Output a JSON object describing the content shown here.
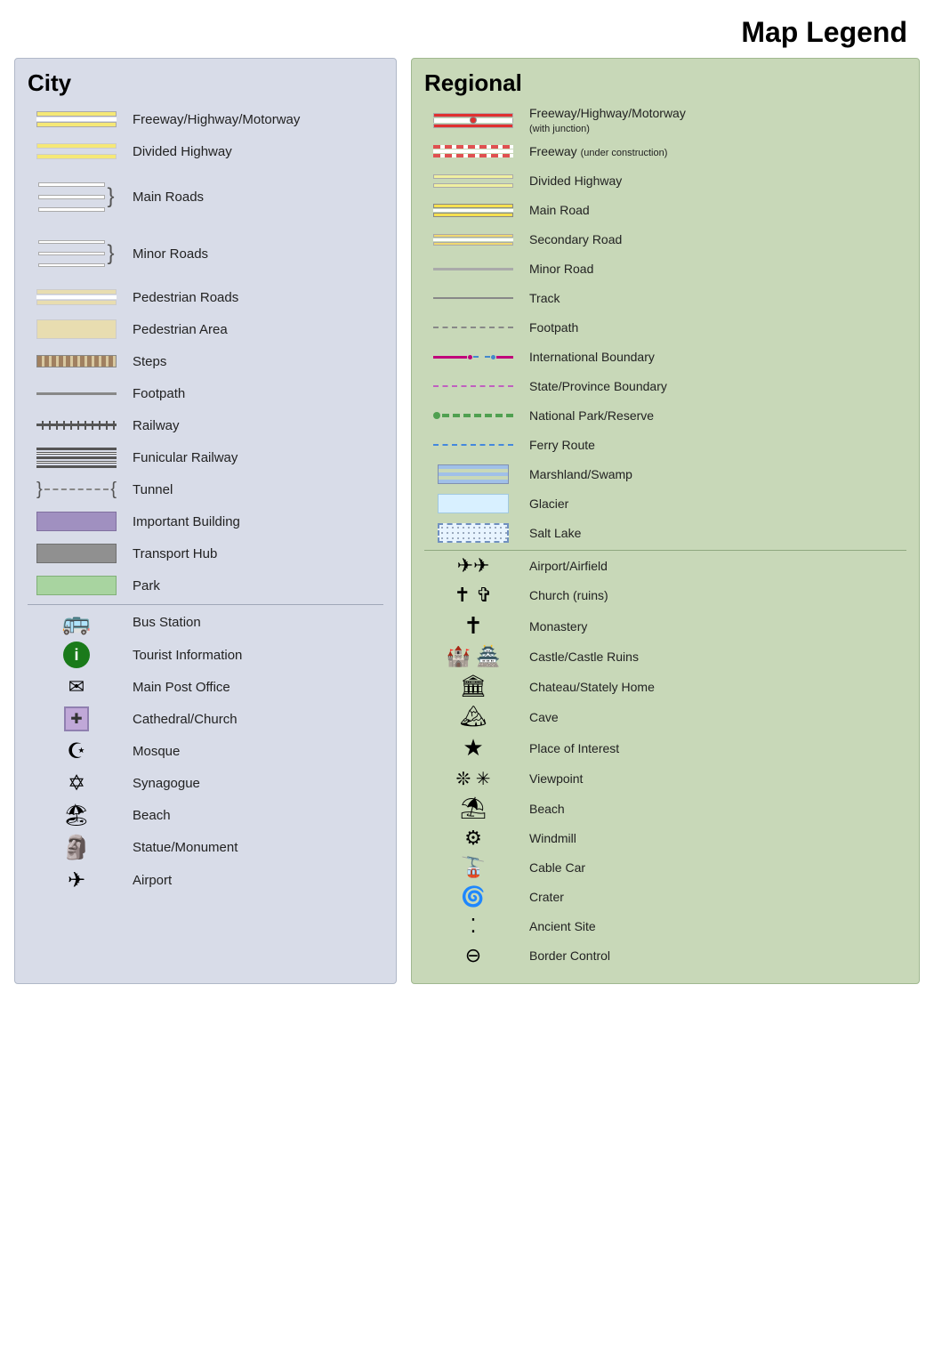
{
  "title": "Map Legend",
  "city": {
    "title": "City",
    "items": [
      {
        "id": "freeway-highway",
        "label": "Freeway/Highway/Motorway"
      },
      {
        "id": "divided-highway",
        "label": "Divided Highway"
      },
      {
        "id": "main-roads",
        "label": "Main Roads"
      },
      {
        "id": "minor-roads",
        "label": "Minor Roads"
      },
      {
        "id": "pedestrian-roads",
        "label": "Pedestrian Roads"
      },
      {
        "id": "pedestrian-area",
        "label": "Pedestrian Area"
      },
      {
        "id": "steps",
        "label": "Steps"
      },
      {
        "id": "footpath",
        "label": "Footpath"
      },
      {
        "id": "railway",
        "label": "Railway"
      },
      {
        "id": "funicular-railway",
        "label": "Funicular Railway"
      },
      {
        "id": "tunnel",
        "label": "Tunnel"
      },
      {
        "id": "important-building",
        "label": "Important Building"
      },
      {
        "id": "transport-hub",
        "label": "Transport Hub"
      },
      {
        "id": "park",
        "label": "Park"
      },
      {
        "id": "bus-station",
        "label": "Bus Station"
      },
      {
        "id": "tourist-information",
        "label": "Tourist Information"
      },
      {
        "id": "main-post-office",
        "label": "Main Post Office"
      },
      {
        "id": "cathedral-church",
        "label": "Cathedral/Church"
      },
      {
        "id": "mosque",
        "label": "Mosque"
      },
      {
        "id": "synagogue",
        "label": "Synagogue"
      },
      {
        "id": "beach",
        "label": "Beach"
      },
      {
        "id": "statue-monument",
        "label": "Statue/Monument"
      },
      {
        "id": "airport",
        "label": "Airport"
      }
    ]
  },
  "regional": {
    "title": "Regional",
    "items": [
      {
        "id": "reg-freeway",
        "label": "Freeway/Highway/Motorway",
        "sublabel": "(with junction)"
      },
      {
        "id": "reg-freeway-construction",
        "label": "Freeway",
        "sublabel": "(under construction)"
      },
      {
        "id": "reg-divided-highway",
        "label": "Divided Highway"
      },
      {
        "id": "reg-main-road",
        "label": "Main Road"
      },
      {
        "id": "reg-secondary-road",
        "label": "Secondary Road"
      },
      {
        "id": "reg-minor-road",
        "label": "Minor Road"
      },
      {
        "id": "reg-track",
        "label": "Track"
      },
      {
        "id": "reg-footpath",
        "label": "Footpath"
      },
      {
        "id": "reg-intl-boundary",
        "label": "International Boundary"
      },
      {
        "id": "reg-state-boundary",
        "label": "State/Province Boundary"
      },
      {
        "id": "reg-national-park",
        "label": "National Park/Reserve"
      },
      {
        "id": "reg-ferry",
        "label": "Ferry Route"
      },
      {
        "id": "reg-marshland",
        "label": "Marshland/Swamp"
      },
      {
        "id": "reg-glacier",
        "label": "Glacier"
      },
      {
        "id": "reg-salt-lake",
        "label": "Salt Lake"
      },
      {
        "id": "reg-airport",
        "label": "Airport/Airfield"
      },
      {
        "id": "reg-church",
        "label": "Church (ruins)"
      },
      {
        "id": "reg-monastery",
        "label": "Monastery"
      },
      {
        "id": "reg-castle",
        "label": "Castle/Castle Ruins"
      },
      {
        "id": "reg-chateau",
        "label": "Chateau/Stately Home"
      },
      {
        "id": "reg-cave",
        "label": "Cave"
      },
      {
        "id": "reg-place-interest",
        "label": "Place of Interest"
      },
      {
        "id": "reg-viewpoint",
        "label": "Viewpoint"
      },
      {
        "id": "reg-beach",
        "label": "Beach"
      },
      {
        "id": "reg-windmill",
        "label": "Windmill"
      },
      {
        "id": "reg-cable-car",
        "label": "Cable Car"
      },
      {
        "id": "reg-crater",
        "label": "Crater"
      },
      {
        "id": "reg-ancient-site",
        "label": "Ancient Site"
      },
      {
        "id": "reg-border-control",
        "label": "Border Control"
      }
    ]
  }
}
